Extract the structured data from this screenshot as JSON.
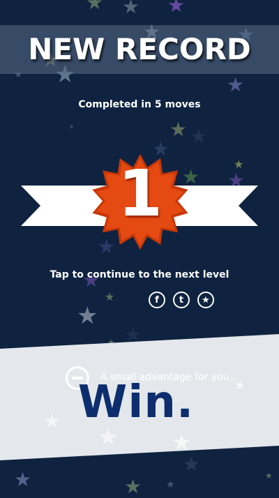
{
  "header": {
    "title": "NEW RECORD",
    "subtitle": "Completed in 5 moves"
  },
  "medal": {
    "number": "1"
  },
  "continue_text": "Tap to continue to the next level",
  "social": {
    "facebook": "f",
    "twitter": "t",
    "rate": "★"
  },
  "bottom": {
    "advantage_text": "A small advantage for you...",
    "win_text": "Win."
  },
  "colors": {
    "background": "#0f2340",
    "medal": "#e54a12",
    "ribbon": "#ffffff",
    "panel": "#e4e8ec",
    "win_text": "#0d2e6e"
  }
}
